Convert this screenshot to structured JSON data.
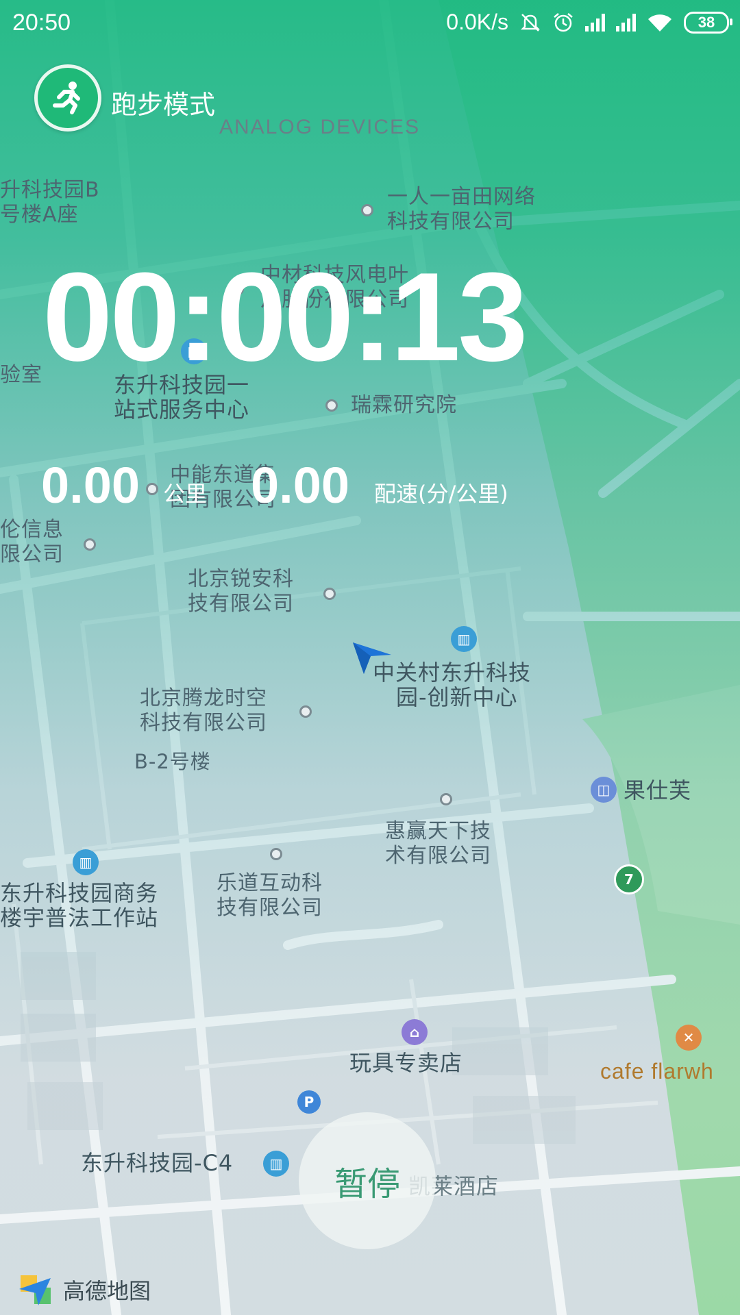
{
  "status_bar": {
    "time": "20:50",
    "net_speed": "0.0K/s",
    "battery": "38",
    "icons": [
      "mute-icon",
      "alarm-icon",
      "hd-signal-icon",
      "signal-icon",
      "wifi-icon",
      "battery-icon"
    ]
  },
  "header": {
    "mode_icon": "running-person-icon",
    "mode_label": "跑步模式"
  },
  "stats": {
    "timer": "00:00:13",
    "distance_value": "0.00",
    "distance_unit": "公里",
    "pace_value": "0.00",
    "pace_unit": "配速(分/公里)"
  },
  "controls": {
    "pause_label": "暂停"
  },
  "map": {
    "provider_label": "高德地图",
    "pois": {
      "analog": "ANALOG DEVICES",
      "b_park_line1": "升科技园B",
      "b_park_line2": "号楼A座",
      "yiren_line1": "一人一亩田网络",
      "yiren_line2": "科技有限公司",
      "zhongcai_line1": "中材科技风电叶",
      "zhongcai_line2": "片股份有限公司",
      "lab": "验室",
      "dongsheng_service_line1": "东升科技园一",
      "dongsheng_service_line2": "站式服务中心",
      "ruilin": "瑞霖研究院",
      "zhongneng_line1": "中能东道集",
      "zhongneng_line2": "团有限公司",
      "lunxin_line1": "伦信息",
      "lunxin_line2": "限公司",
      "ruian_line1": "北京锐安科",
      "ruian_line2": "技有限公司",
      "zgc_line1": "中关村东升科技",
      "zgc_line2": "园-创新中心",
      "tenglong_line1": "北京腾龙时空",
      "tenglong_line2": "科技有限公司",
      "b2": "B-2号楼",
      "guoshifu": "果仕芙",
      "huiying_line1": "惠赢天下技",
      "huiying_line2": "术有限公司",
      "shangwu_line1": "东升科技园商务",
      "shangwu_line2": "楼宇普法工作站",
      "ledao_line1": "乐道互动科",
      "ledao_line2": "技有限公司",
      "toystore": "玩具专卖店",
      "cafe": "cafe flarwh",
      "c4": "东升科技园-C4",
      "kailai": "凯莱酒店"
    }
  }
}
